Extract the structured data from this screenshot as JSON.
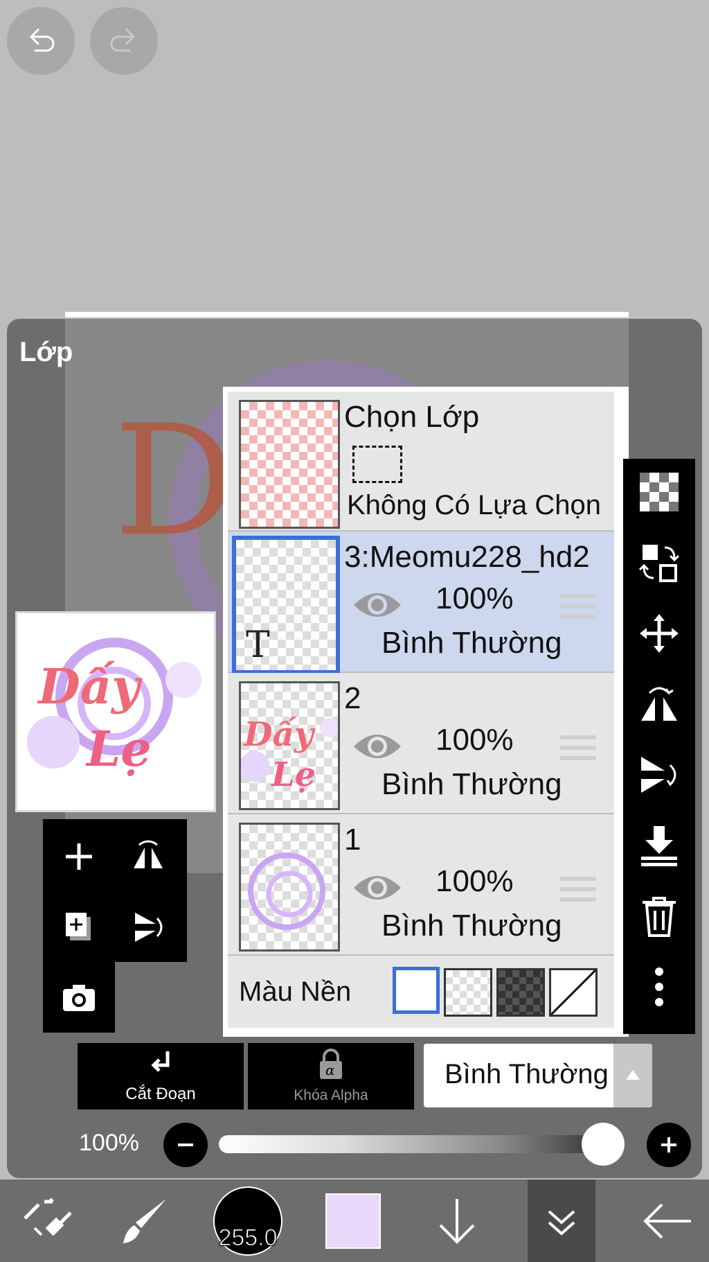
{
  "top": {
    "undo_icon": "undo-icon",
    "redo_icon": "redo-icon"
  },
  "panel": {
    "title": "Lớp",
    "selection_row": {
      "title": "Chọn Lớp",
      "subtitle": "Không Có Lựa Chọn"
    },
    "layers": [
      {
        "name": "3:Meomu228_hd2",
        "opacity": "100%",
        "blend": "Bình Thường",
        "selected": true,
        "type": "text"
      },
      {
        "name": "2",
        "opacity": "100%",
        "blend": "Bình Thường",
        "selected": false
      },
      {
        "name": "1",
        "opacity": "100%",
        "blend": "Bình Thường",
        "selected": false
      }
    ],
    "background_label": "Màu Nền"
  },
  "controls": {
    "clip_label": "Cắt Đoạn",
    "alpha_lock_label": "Khóa Alpha",
    "blend_mode": "Bình Thường",
    "opacity_label": "100%",
    "opacity_value": 1.0
  },
  "toolbar": {
    "brush_size": "255.0",
    "current_color": "#ead9fb"
  },
  "colors": {
    "selected_row": "#cdd8ee",
    "accent": "#3b6fd6",
    "panel": "#6d6d6d"
  }
}
